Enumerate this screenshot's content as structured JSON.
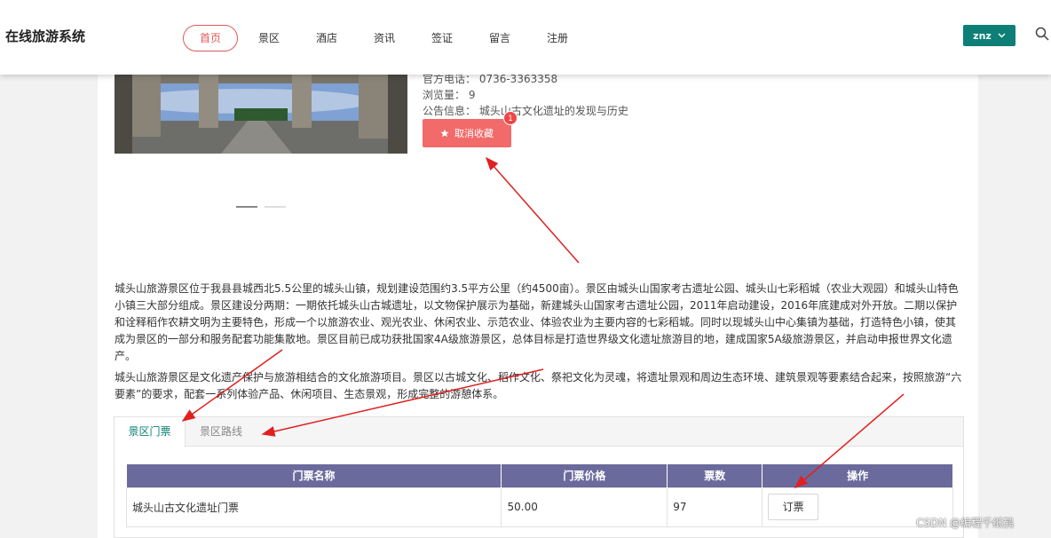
{
  "header": {
    "brand": "在线旅游系统",
    "nav": [
      "首页",
      "景区",
      "酒店",
      "资讯",
      "签证",
      "留言",
      "注册"
    ],
    "user": "znz"
  },
  "attraction": {
    "phone": "官方电话： 0736-3363358",
    "views": "浏览量： 9",
    "notice": "公告信息： 城头山古文化遗址的发现与历史",
    "favorite_btn": "取消收藏",
    "favorite_count": "1"
  },
  "description": {
    "p1": "城头山旅游景区位于我县县城西北5.5公里的城头山镇，规划建设范围约3.5平方公里（约4500亩）。景区由城头山国家考古遗址公园、城头山七彩稻城（农业大观园）和城头山特色小镇三大部分组成。景区建设分两期：一期依托城头山古城遗址，以文物保护展示为基础，新建城头山国家考古遗址公园，2011年启动建设，2016年底建成对外开放。二期以保护和诠释稻作农耕文明为主要特色，形成一个以旅游农业、观光农业、休闲农业、示范农业、体验农业为主要内容的七彩稻城。同时以现城头山中心集镇为基础，打造特色小镇，使其成为景区的一部分和服务配套功能集散地。景区目前已成功获批国家4A级旅游景区，总体目标是打造世界级文化遗址旅游目的地，建成国家5A级旅游景区，并启动申报世界文化遗产。",
    "p2": "城头山旅游景区是文化遗产保护与旅游相结合的文化旅游项目。景区以古城文化、稻作文化、祭祀文化为灵魂，将遗址景观和周边生态环境、建筑景观等要素结合起来，按照旅游“六要素”的要求，配套一系列体验产品、休闲项目、生态景观，形成完整的游憩体系。"
  },
  "tabs": [
    "景区门票",
    "景区路线"
  ],
  "tickets": {
    "headers": [
      "门票名称",
      "门票价格",
      "票数",
      "操作"
    ],
    "rows": [
      {
        "name": "城头山古文化遗址门票",
        "price": "50.00",
        "count": "97",
        "action": "订票"
      }
    ]
  },
  "watermark": "CSDN @编程千纸鹤",
  "colors": {
    "accent": "#0d7f76",
    "favorite": "#f26a6a",
    "table_header": "#6b6a9c",
    "nav_active": "#e05a5a",
    "annotation_arrow": "#e02020"
  }
}
